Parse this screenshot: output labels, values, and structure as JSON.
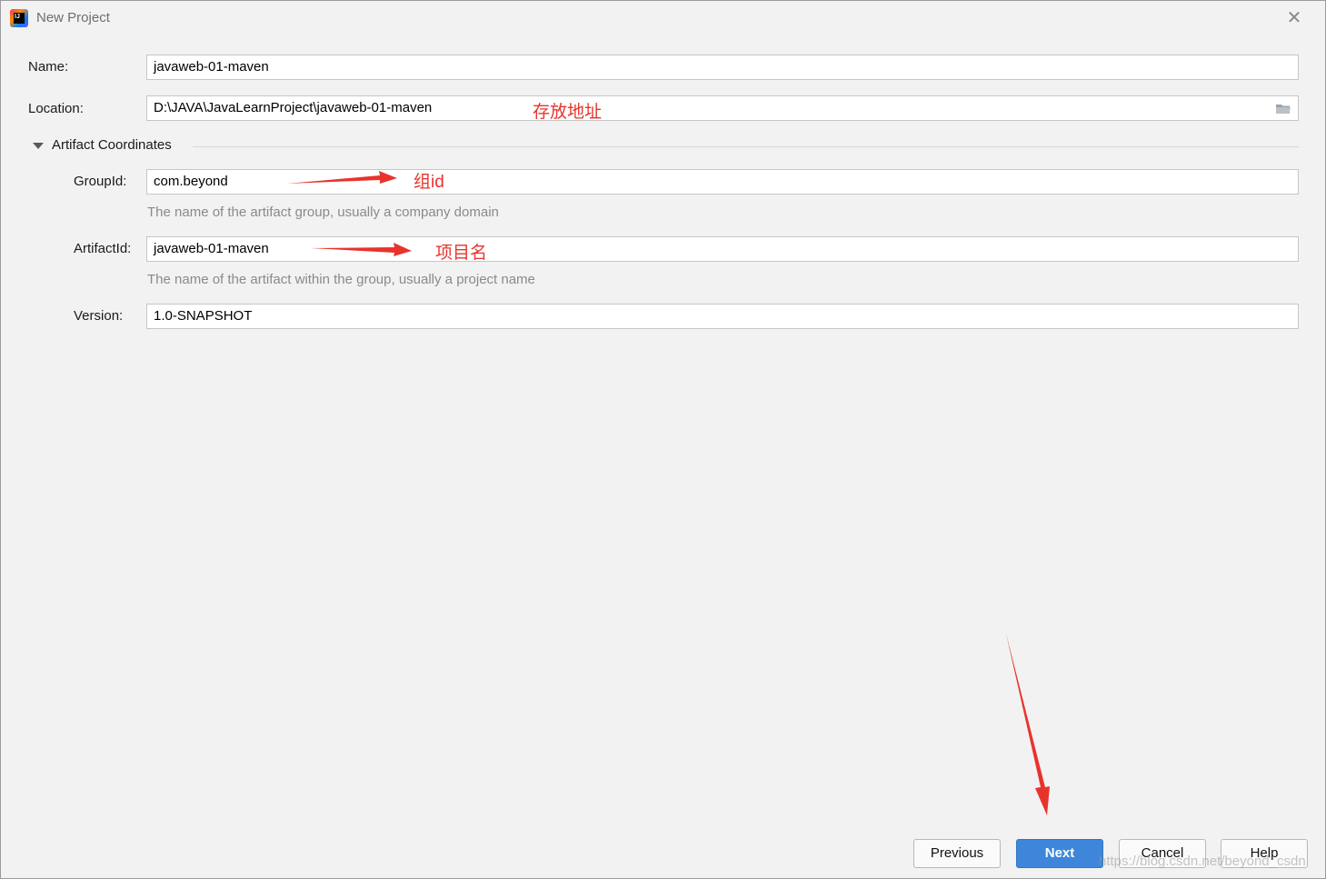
{
  "window": {
    "title": "New Project"
  },
  "form": {
    "name": {
      "label": "Name:",
      "value": "javaweb-01-maven"
    },
    "location": {
      "label": "Location:",
      "value": "D:\\JAVA\\JavaLearnProject\\javaweb-01-maven"
    },
    "section_title": "Artifact Coordinates",
    "group_id": {
      "label": "GroupId:",
      "value": "com.beyond",
      "hint": "The name of the artifact group, usually a company domain"
    },
    "artifact_id": {
      "label": "ArtifactId:",
      "value": "javaweb-01-maven",
      "hint": "The name of the artifact within the group, usually a project name"
    },
    "version": {
      "label": "Version:",
      "value": "1.0-SNAPSHOT"
    }
  },
  "annotations": {
    "location_note": "存放地址",
    "group_note": "组id",
    "artifact_note": "项目名",
    "color": "#e8332d"
  },
  "buttons": {
    "previous": "Previous",
    "next": "Next",
    "cancel": "Cancel",
    "help": "Help"
  },
  "watermark": "https://blog.csdn.net/beyond_csdn",
  "colors": {
    "primary_button": "#3d86d9",
    "background": "#f2f2f2"
  },
  "icons": {
    "app": "intellij-idea-icon",
    "close": "close-icon",
    "folder": "folder-icon",
    "collapse": "triangle-down-icon"
  }
}
